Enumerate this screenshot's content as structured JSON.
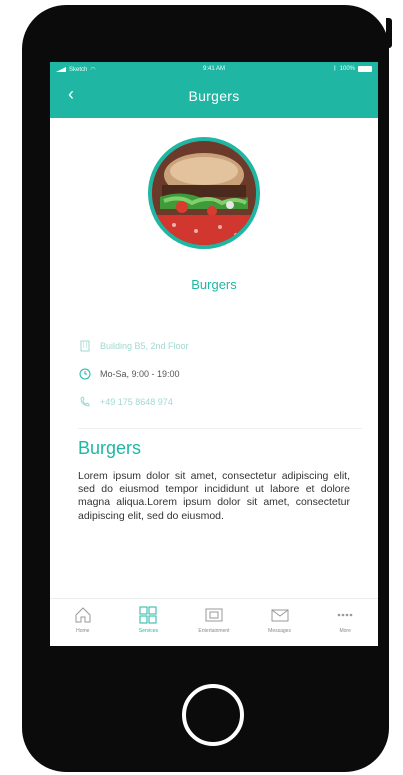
{
  "status_bar": {
    "carrier": "Sketch",
    "time": "9:41 AM",
    "battery": "100%"
  },
  "header": {
    "back_glyph": "‹",
    "title": "Burgers"
  },
  "profile": {
    "name": "Burgers",
    "accent_color": "#1fb7a3"
  },
  "info": {
    "address": "Building B5, 2nd Floor",
    "hours": "Mo-Sa, 9:00 - 19:00",
    "phone": "+49 175 8648 974"
  },
  "description": {
    "title": "Burgers",
    "text": "Lorem ipsum dolor sit amet, consectetur adipiscing elit, sed do eiusmod tempor incididunt ut labore et dolore magna aliqua.Lorem ipsum dolor sit amet, consectetur adipiscing elit, sed do eiusmod."
  },
  "tabs": [
    {
      "label": "Home",
      "icon": "home-icon"
    },
    {
      "label": "Services",
      "icon": "grid-icon"
    },
    {
      "label": "Entertainment",
      "icon": "film-icon"
    },
    {
      "label": "Messages",
      "icon": "envelope-icon"
    },
    {
      "label": "More",
      "icon": "more-icon"
    }
  ]
}
